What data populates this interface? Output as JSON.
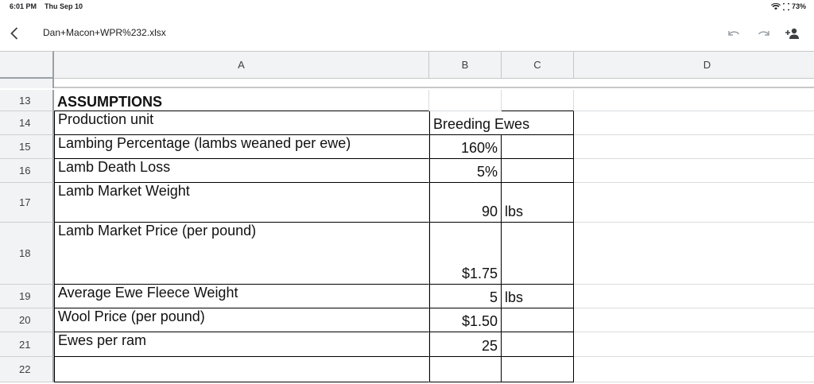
{
  "status": {
    "time": "6:01 PM",
    "date": "Thu Sep 10",
    "battery": "73%"
  },
  "toolbar": {
    "file_name": "Dan+Macon+WPR%232.xlsx"
  },
  "columns": [
    "A",
    "B",
    "C",
    "D"
  ],
  "rows": [
    {
      "num": "13",
      "a": "ASSUMPTIONS",
      "b": "",
      "c": ""
    },
    {
      "num": "14",
      "a": "Production unit",
      "b": "Breeding Ewes",
      "c": ""
    },
    {
      "num": "15",
      "a": "Lambing Percentage (lambs weaned per ewe)",
      "b": "160%",
      "c": ""
    },
    {
      "num": "16",
      "a": "Lamb Death Loss",
      "b": "5%",
      "c": ""
    },
    {
      "num": "17",
      "a": "Lamb Market Weight",
      "b": "90",
      "c": "lbs"
    },
    {
      "num": "18",
      "a": "Lamb Market Price (per pound)",
      "b": "$1.75",
      "c": ""
    },
    {
      "num": "19",
      "a": "Average Ewe Fleece Weight",
      "b": "5",
      "c": "lbs"
    },
    {
      "num": "20",
      "a": "Wool Price (per pound)",
      "b": "$1.50",
      "c": ""
    },
    {
      "num": "21",
      "a": "Ewes per ram",
      "b": "25",
      "c": ""
    },
    {
      "num": "22",
      "a": "",
      "b": "",
      "c": ""
    }
  ]
}
